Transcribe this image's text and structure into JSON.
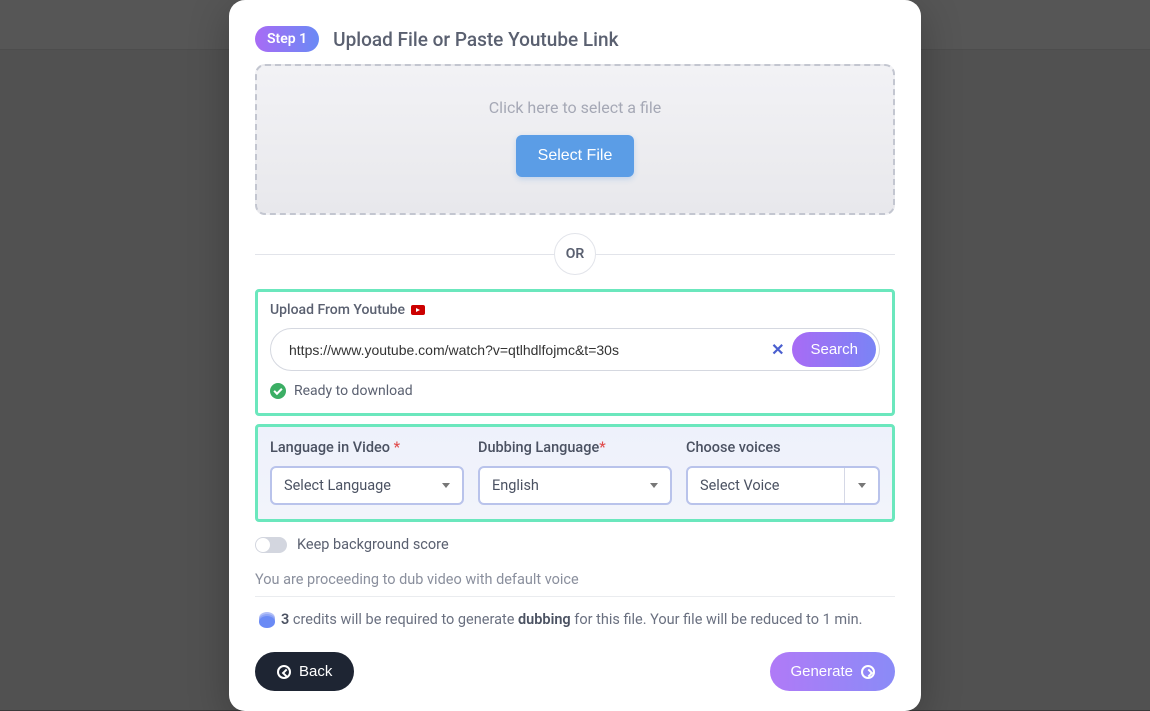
{
  "step": {
    "badge": "Step 1",
    "title": "Upload File or Paste Youtube Link"
  },
  "dropzone": {
    "hint": "Click here to select a file",
    "button": "Select File"
  },
  "divider": {
    "or": "OR"
  },
  "youtube": {
    "label": "Upload From Youtube",
    "url": "https://www.youtube.com/watch?v=qtlhdlfojmc&t=30s",
    "search": "Search",
    "ready": "Ready to download"
  },
  "languages": {
    "source_label": "Language in Video",
    "source_value": "Select Language",
    "dub_label": "Dubbing Language",
    "dub_value": "English",
    "voice_label": "Choose voices",
    "voice_value": "Select Voice"
  },
  "toggle": {
    "label": "Keep background score"
  },
  "info": "You are proceeding to dub video with default voice",
  "credits": {
    "count": "3",
    "prefix": " credits will be required to generate ",
    "bold_word": "dubbing",
    "suffix": " for this file. Your file will be reduced to 1 min."
  },
  "footer": {
    "back": "Back",
    "generate": "Generate"
  }
}
